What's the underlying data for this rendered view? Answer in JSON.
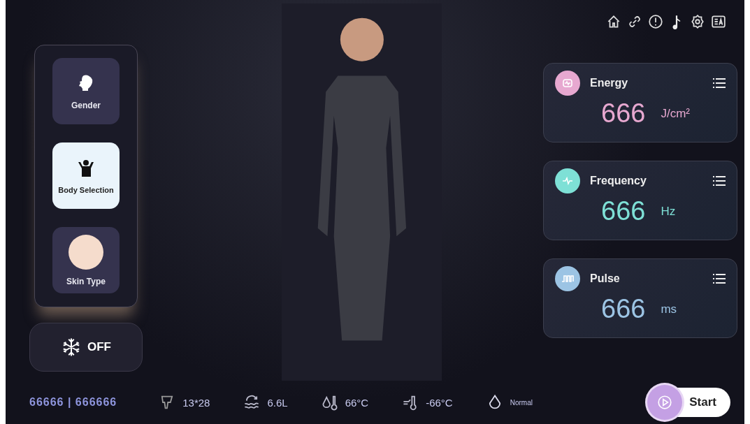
{
  "toolbar": [
    {
      "kind": "home"
    },
    {
      "kind": "link"
    },
    {
      "kind": "alert"
    },
    {
      "kind": "music"
    },
    {
      "kind": "settings"
    },
    {
      "kind": "language"
    }
  ],
  "modes": [
    {
      "label": "Gender",
      "kind": "head",
      "selected": false
    },
    {
      "label": "Body Selection",
      "kind": "body",
      "selected": true
    },
    {
      "label": "Skin Type",
      "kind": "swatch",
      "selected": false
    }
  ],
  "cooling": {
    "label": "OFF"
  },
  "parameters": [
    {
      "name": "Energy",
      "value": "666",
      "unit": "J/cm²",
      "kind": "energy",
      "color": "#e7a8d0"
    },
    {
      "name": "Frequency",
      "value": "666",
      "unit": "Hz",
      "kind": "frequency",
      "color": "#7ee0d6"
    },
    {
      "name": "Pulse",
      "value": "666",
      "unit": "ms",
      "kind": "pulse",
      "color": "#9cc4e4"
    }
  ],
  "status_bar": {
    "counter": "66666 | 666666",
    "items": [
      {
        "kind": "handpiece",
        "text": "13*28"
      },
      {
        "kind": "water",
        "text": "6.6L"
      },
      {
        "kind": "water-temp",
        "text": "66°C"
      },
      {
        "kind": "cool-temp",
        "text": "-66°C"
      },
      {
        "kind": "drop",
        "text": "Normal"
      }
    ],
    "start": "Start"
  }
}
